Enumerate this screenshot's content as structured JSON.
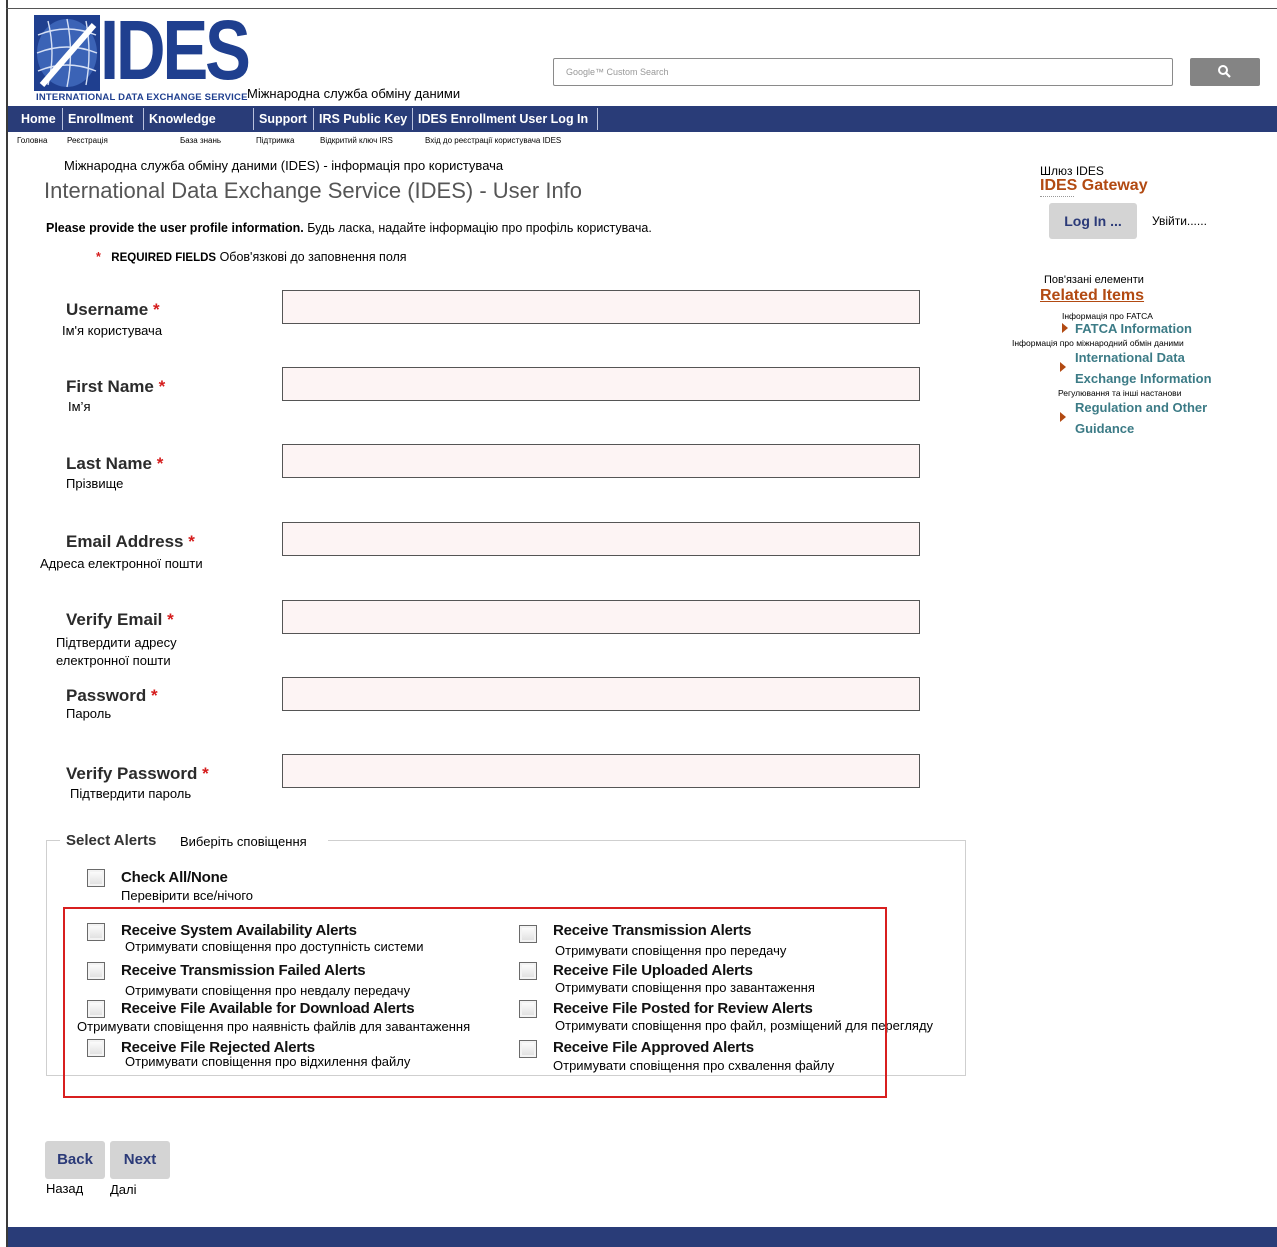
{
  "header": {
    "logo_text": "IDES",
    "logo_subtitle": "INTERNATIONAL DATA EXCHANGE SERVICE",
    "logo_subtitle_uk": "Міжнародна служба обміну даними",
    "search_placeholder": "Google™ Custom Search"
  },
  "nav": {
    "items": [
      {
        "label": "Home",
        "sub": "Головна"
      },
      {
        "label": "Enrollment",
        "sub": "Реєстрація"
      },
      {
        "label": "Knowledge Base",
        "sub": "База знань"
      },
      {
        "label": "Support",
        "sub": "Підтримка"
      },
      {
        "label": "IRS Public Key",
        "sub": "Відкритий ключ IRS"
      },
      {
        "label": "IDES Enrollment User Log In",
        "sub": "Вхід до реєстрації користувача IDES"
      }
    ]
  },
  "page": {
    "title_uk": "Міжнародна служба обміну даними (IDES) - інформація про користувача",
    "title_en": "International Data Exchange Service (IDES) - User Info",
    "provide_en": "Please provide the user profile information.",
    "provide_uk": "Будь ласка, надайте інформацію про профіль користувача.",
    "required_star": "*",
    "required_en": "REQUIRED FIELDS",
    "required_uk": "Обов'язкові до заповнення поля"
  },
  "form": {
    "fields": [
      {
        "label": "Username",
        "sub": "Ім'я користувача",
        "value": ""
      },
      {
        "label": "First Name",
        "sub": "Ім’я",
        "value": ""
      },
      {
        "label": "Last Name",
        "sub": "Прізвище",
        "value": ""
      },
      {
        "label": "Email Address",
        "sub": "Адреса електронної пошти",
        "value": ""
      },
      {
        "label": "Verify Email",
        "sub": "Підтвердити адресу електронної пошти",
        "value": ""
      },
      {
        "label": "Password",
        "sub": "Пароль",
        "value": ""
      },
      {
        "label": "Verify Password",
        "sub": "Підтвердити пароль",
        "value": ""
      }
    ],
    "star": "*"
  },
  "alerts": {
    "legend_en": "Select Alerts",
    "legend_uk": "Виберіть сповіщення",
    "check_all": {
      "label": "Check All/None",
      "sub": "Перевірити все/нічого",
      "checked": false
    },
    "items": [
      {
        "label": "Receive System Availability Alerts",
        "sub": "Отримувати сповіщення про доступність системи",
        "checked": false
      },
      {
        "label": "Receive Transmission Alerts",
        "sub": "Отримувати сповіщення про передачу",
        "checked": false
      },
      {
        "label": "Receive Transmission Failed Alerts",
        "sub": "Отримувати сповіщення про невдалу передачу",
        "checked": false
      },
      {
        "label": "Receive File Uploaded Alerts",
        "sub": "Отримувати сповіщення про завантаження",
        "checked": false
      },
      {
        "label": "Receive File Available for Download Alerts",
        "sub": "Отримувати сповіщення про наявність файлів для завантаження",
        "checked": false
      },
      {
        "label": "Receive File Posted for Review Alerts",
        "sub": "Отримувати сповіщення про файл, розміщений для перегляду",
        "checked": false
      },
      {
        "label": "Receive File Rejected Alerts",
        "sub": "Отримувати сповіщення про відхилення файлу",
        "checked": false
      },
      {
        "label": "Receive File Approved Alerts",
        "sub": "Отримувати сповіщення про схвалення файлу",
        "checked": false
      }
    ]
  },
  "buttons": {
    "back": "Back",
    "back_uk": "Назад",
    "next": "Next",
    "next_uk": "Далі"
  },
  "sidebar": {
    "gateway_uk": "Шлюз IDES",
    "gateway_en": "IDES Gateway",
    "login_label": "Log In ...",
    "login_uk": "Увійти......",
    "related_uk": "Пов'язані елементи",
    "related_en": "Related Items",
    "links": [
      {
        "uk": "Інформація про FATCA",
        "line1": "FATCA Information",
        "line2": ""
      },
      {
        "uk": "Інформація про міжнародний обмін даними",
        "line1": "International Data",
        "line2": "Exchange Information"
      },
      {
        "uk": "Регулювання та інші настанови",
        "line1": "Regulation and Other",
        "line2": "Guidance"
      }
    ]
  },
  "colors": {
    "nav_bg": "#293c78",
    "accent_orange": "#b24a12",
    "link_teal": "#3c7b86",
    "required_red": "#d51c1c",
    "highlight_box": "#d81f1f"
  }
}
